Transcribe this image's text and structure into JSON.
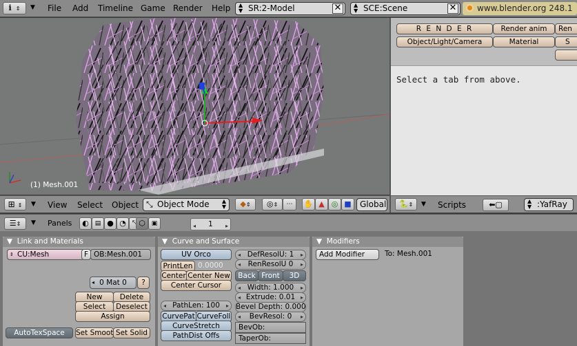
{
  "top_header": {
    "menus": [
      "File",
      "Add",
      "Timeline",
      "Game",
      "Render",
      "Help"
    ],
    "screen_name": "SR:2-Model",
    "scene_name": "SCE:Scene",
    "version_text": "www.blender.org 248.1"
  },
  "view3d": {
    "object_label": "(1) Mesh.001",
    "header": {
      "view_menu": "View",
      "select_menu": "Select",
      "object_menu": "Object",
      "mode": "Object Mode",
      "orientation": "Global"
    }
  },
  "render_panel": {
    "tabs_row1": [
      "R E N D E R",
      "Render anim",
      "Ren"
    ],
    "tabs_row2": [
      "Object/Light/Camera",
      "Material",
      "S"
    ],
    "message": "Select a tab from above."
  },
  "scripts_header": {
    "menu": "Scripts",
    "script": ":YafRay"
  },
  "buttons_header": {
    "panels_label": "Panels",
    "frame": "1"
  },
  "link_materials": {
    "title": "Link and Materials",
    "curve_field": "CU:Mesh",
    "f_label": "F",
    "ob_field": "OB:Mesh.001",
    "mat_field": "0 Mat 0",
    "q_label": "?",
    "new": "New",
    "delete": "Delete",
    "select": "Select",
    "deselect": "Deselect",
    "assign": "Assign",
    "autotex": "AutoTexSpace",
    "set_smooth": "Set Smoot",
    "set_solid": "Set Solid"
  },
  "curve_surface": {
    "title": "Curve and Surface",
    "uv_orco": "UV Orco",
    "print_len": "PrintLen",
    "print_len_value": "0.0000",
    "center": "Center",
    "center_new": "Center New",
    "center_cursor": "Center Cursor",
    "def_resol": "DefResolU: 1",
    "ren_resol": "RenResolU 0",
    "back": "Back",
    "front": "Front",
    "three_d": "3D",
    "width": "Width: 1.000",
    "extrude": "Extrude: 0.01",
    "bevel_depth": "Bevel Depth: 0.000",
    "bev_resol": "BevResol: 0",
    "bev_ob": "BevOb:",
    "taper_ob": "TaperOb:",
    "path_len": "PathLen: 100",
    "curve_path": "CurvePat",
    "curve_follow": "CurveFoll",
    "curve_stretch": "CurveStretch",
    "path_dist_offs": "PathDist Offs"
  },
  "modifiers": {
    "title": "Modifiers",
    "add_modifier": "Add Modifier",
    "to_label": "To: Mesh.001"
  }
}
